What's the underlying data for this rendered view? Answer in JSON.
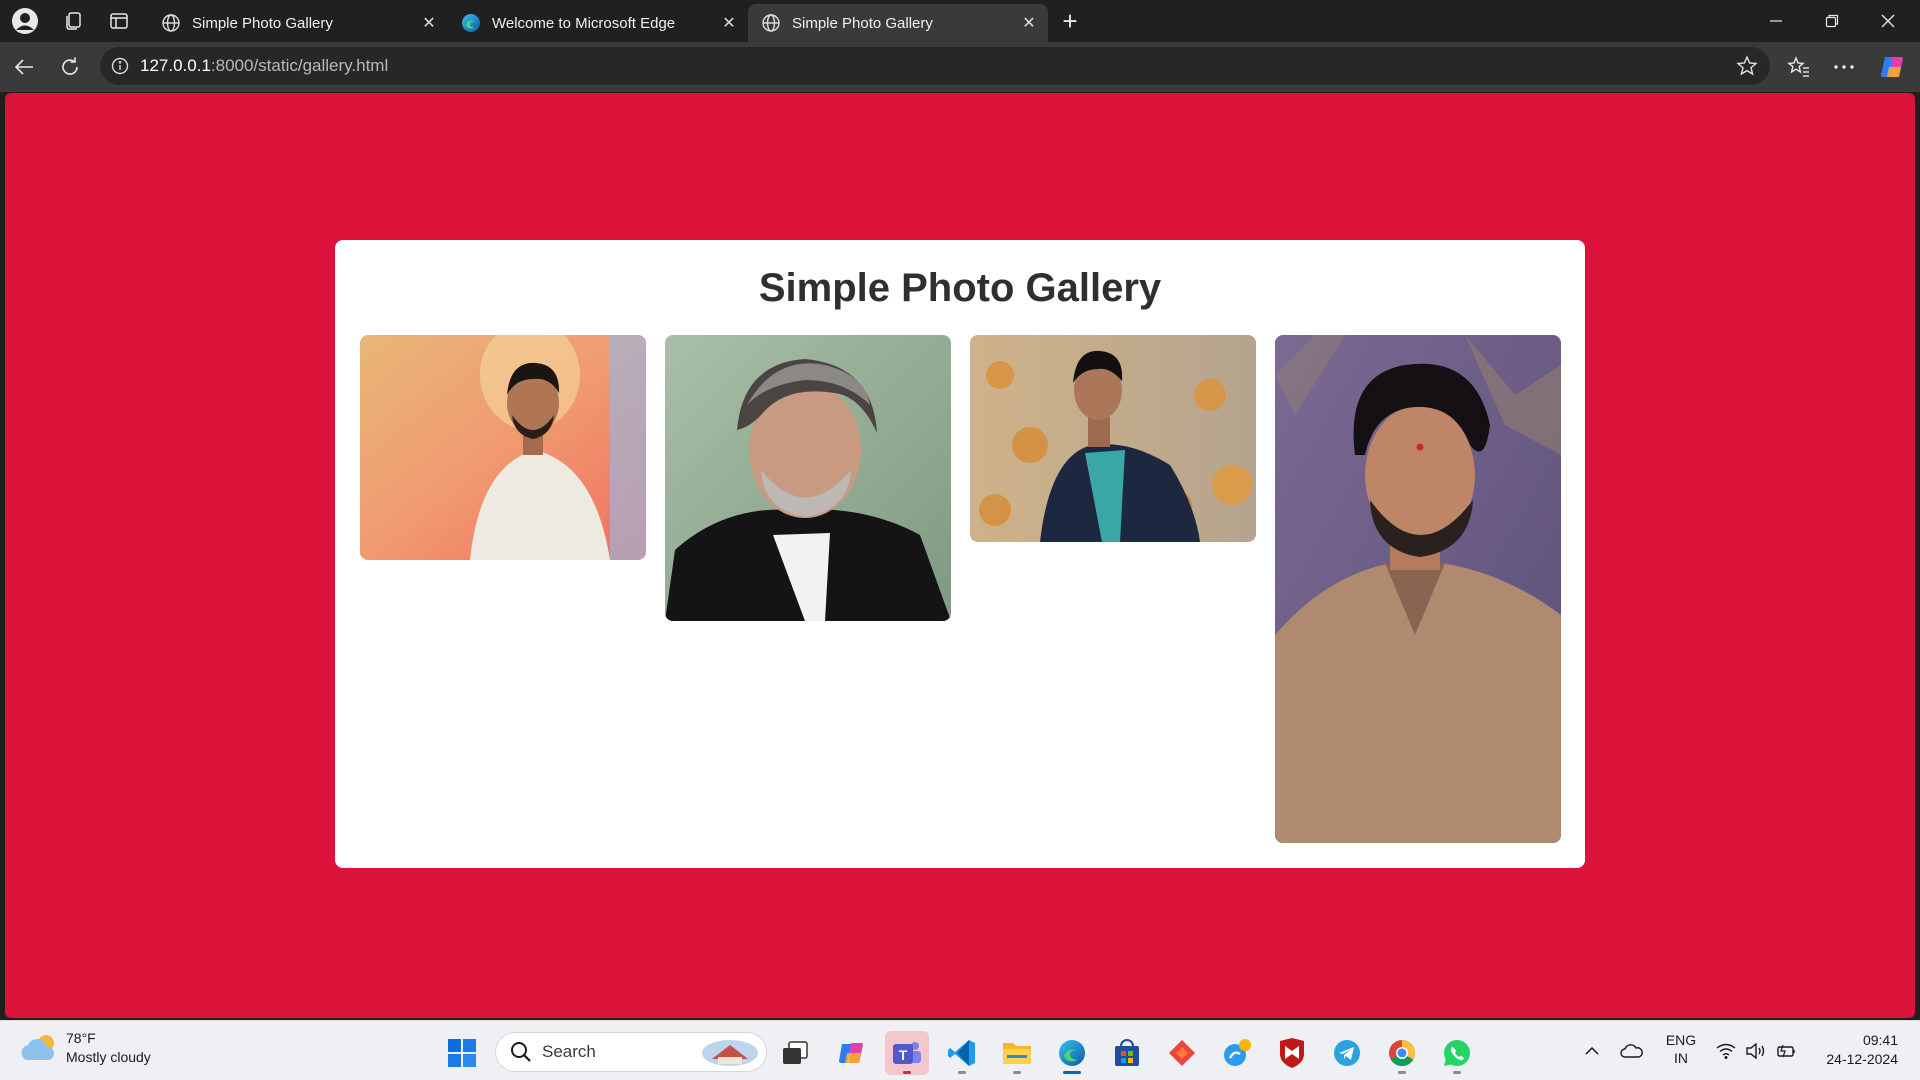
{
  "tabs": [
    {
      "title": "Simple Photo Gallery",
      "favicon": "globe-icon",
      "active": false
    },
    {
      "title": "Welcome to Microsoft Edge",
      "favicon": "edge-icon",
      "active": false
    },
    {
      "title": "Simple Photo Gallery",
      "favicon": "globe-icon",
      "active": true
    }
  ],
  "address": {
    "host": "127.0.0.1",
    "path": ":8000/static/gallery.html"
  },
  "page": {
    "background": "#dc143c",
    "title": "Simple Photo Gallery",
    "photos": [
      {
        "alt": "Man in white linen shirt, warm orange background"
      },
      {
        "alt": "Man with grey hair in black jacket"
      },
      {
        "alt": "Man in navy blazer with orange blossoms behind"
      },
      {
        "alt": "Man in tan shirt, purple backdrop"
      }
    ]
  },
  "taskbar": {
    "weather": {
      "temp": "78°F",
      "desc": "Mostly cloudy"
    },
    "search_placeholder": "Search",
    "lang": {
      "line1": "ENG",
      "line2": "IN"
    },
    "clock": {
      "time": "09:41",
      "date": "24-12-2024"
    }
  }
}
